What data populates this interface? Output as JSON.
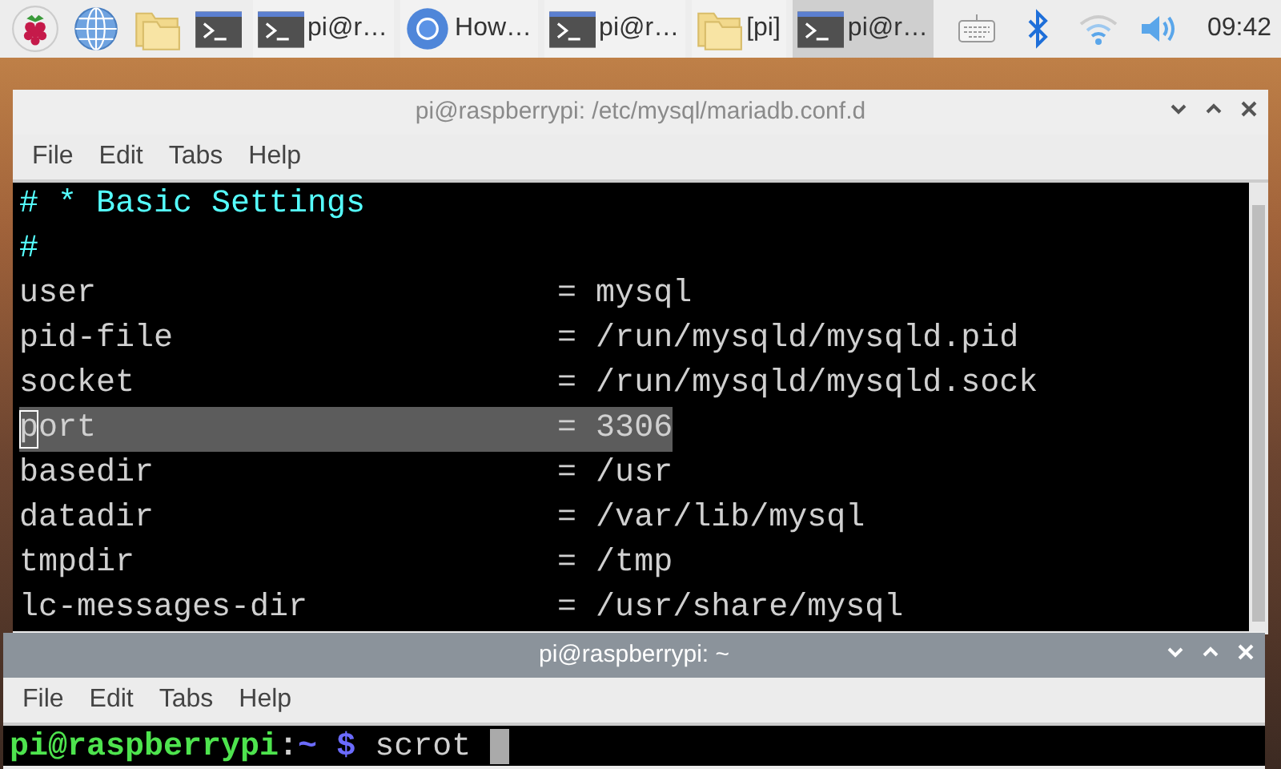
{
  "taskbar": {
    "launchers": [
      {
        "kind": "raspberry"
      },
      {
        "kind": "globe"
      },
      {
        "kind": "folder"
      },
      {
        "kind": "terminal"
      }
    ],
    "tasks": [
      {
        "kind": "terminal",
        "label": "pi@r…",
        "selected": false
      },
      {
        "kind": "chromium",
        "label": "How…",
        "selected": false
      },
      {
        "kind": "terminal",
        "label": "pi@r…",
        "selected": false
      },
      {
        "kind": "folder",
        "label": "[pi]",
        "selected": false
      },
      {
        "kind": "terminal",
        "label": "pi@r…",
        "selected": true
      }
    ],
    "tray": [
      {
        "kind": "keyboard"
      },
      {
        "kind": "bluetooth"
      },
      {
        "kind": "wifi"
      },
      {
        "kind": "volume"
      }
    ],
    "clock": "09:42"
  },
  "windows": [
    {
      "title": "pi@raspberrypi: /etc/mysql/mariadb.conf.d",
      "focused": false,
      "menu": [
        "File",
        "Edit",
        "Tabs",
        "Help"
      ],
      "lines": [
        {
          "kind": "comment",
          "text": "# * Basic Settings",
          "selected": false,
          "cursor": false
        },
        {
          "kind": "comment",
          "text": "#",
          "selected": false,
          "cursor": false
        },
        {
          "kind": "setting",
          "text": "user                        = mysql",
          "selected": false,
          "cursor": false
        },
        {
          "kind": "setting",
          "text": "pid-file                    = /run/mysqld/mysqld.pid",
          "selected": false,
          "cursor": false
        },
        {
          "kind": "setting",
          "text": "socket                      = /run/mysqld/mysqld.sock",
          "selected": false,
          "cursor": false
        },
        {
          "kind": "setting",
          "text": "port                        = 3306",
          "selected": true,
          "cursor": true
        },
        {
          "kind": "setting",
          "text": "basedir                     = /usr",
          "selected": false,
          "cursor": false
        },
        {
          "kind": "setting",
          "text": "datadir                     = /var/lib/mysql",
          "selected": false,
          "cursor": false
        },
        {
          "kind": "setting",
          "text": "tmpdir                      = /tmp",
          "selected": false,
          "cursor": false
        },
        {
          "kind": "setting",
          "text": "lc-messages-dir             = /usr/share/mysql",
          "selected": false,
          "cursor": false
        }
      ]
    },
    {
      "title": "pi@raspberrypi: ~",
      "focused": true,
      "menu": [
        "File",
        "Edit",
        "Tabs",
        "Help"
      ],
      "prompt": {
        "user_host": "pi@raspberrypi",
        "separator": ":",
        "path": "~",
        "symbol": "$",
        "command": "scrot"
      }
    }
  ]
}
